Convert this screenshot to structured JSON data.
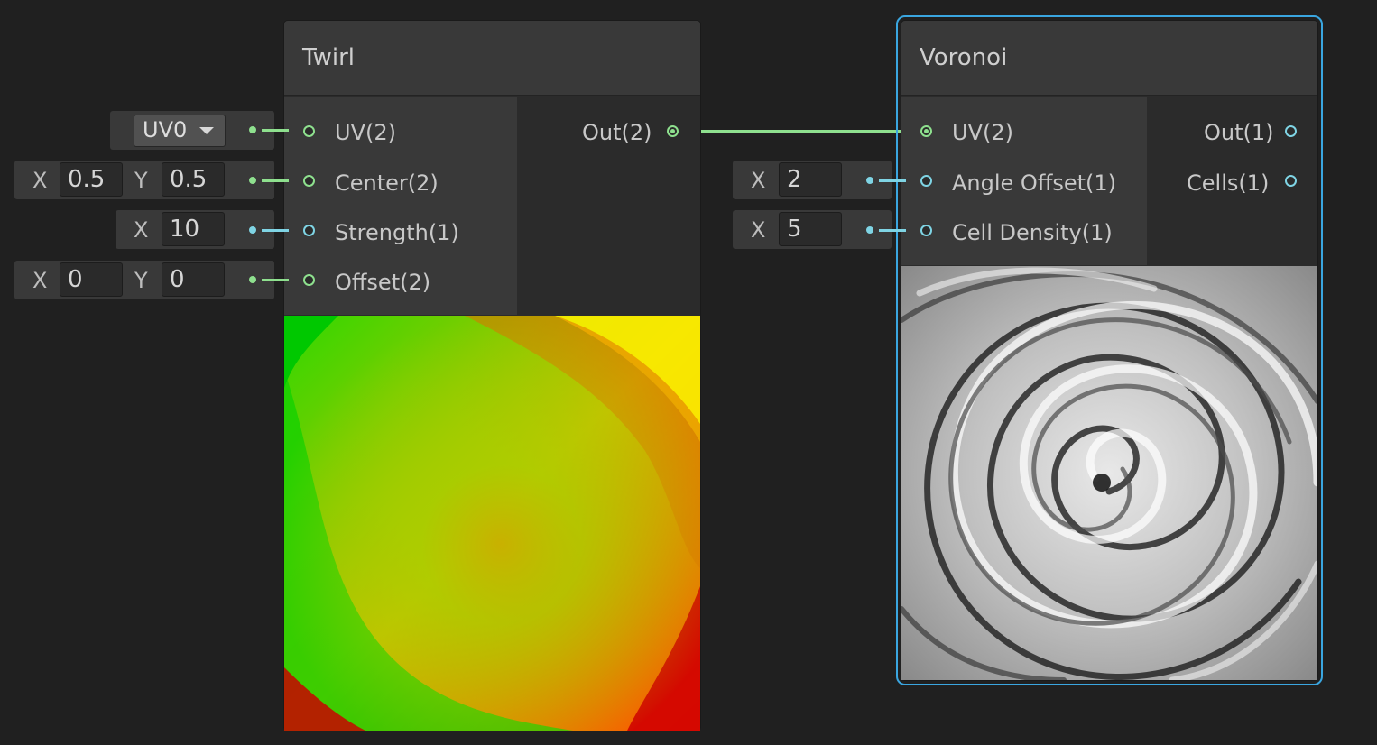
{
  "twirl": {
    "title": "Twirl",
    "inputs": [
      "UV(2)",
      "Center(2)",
      "Strength(1)",
      "Offset(2)"
    ],
    "output": "Out(2)",
    "uv_channel": "UV0",
    "center": {
      "x_label": "X",
      "x": "0.5",
      "y_label": "Y",
      "y": "0.5"
    },
    "strength": {
      "x_label": "X",
      "x": "10"
    },
    "offset": {
      "x_label": "X",
      "x": "0",
      "y_label": "Y",
      "y": "0"
    }
  },
  "voronoi": {
    "title": "Voronoi",
    "inputs": [
      "UV(2)",
      "Angle Offset(1)",
      "Cell Density(1)"
    ],
    "outputs": [
      "Out(1)",
      "Cells(1)"
    ],
    "angle_offset": {
      "x_label": "X",
      "x": "2"
    },
    "cell_density": {
      "x_label": "X",
      "x": "5"
    }
  },
  "colors": {
    "background": "#202020",
    "vector2_port": "#8ee08e",
    "float_port": "#7fd4e4",
    "selection": "#3aa6e0"
  }
}
